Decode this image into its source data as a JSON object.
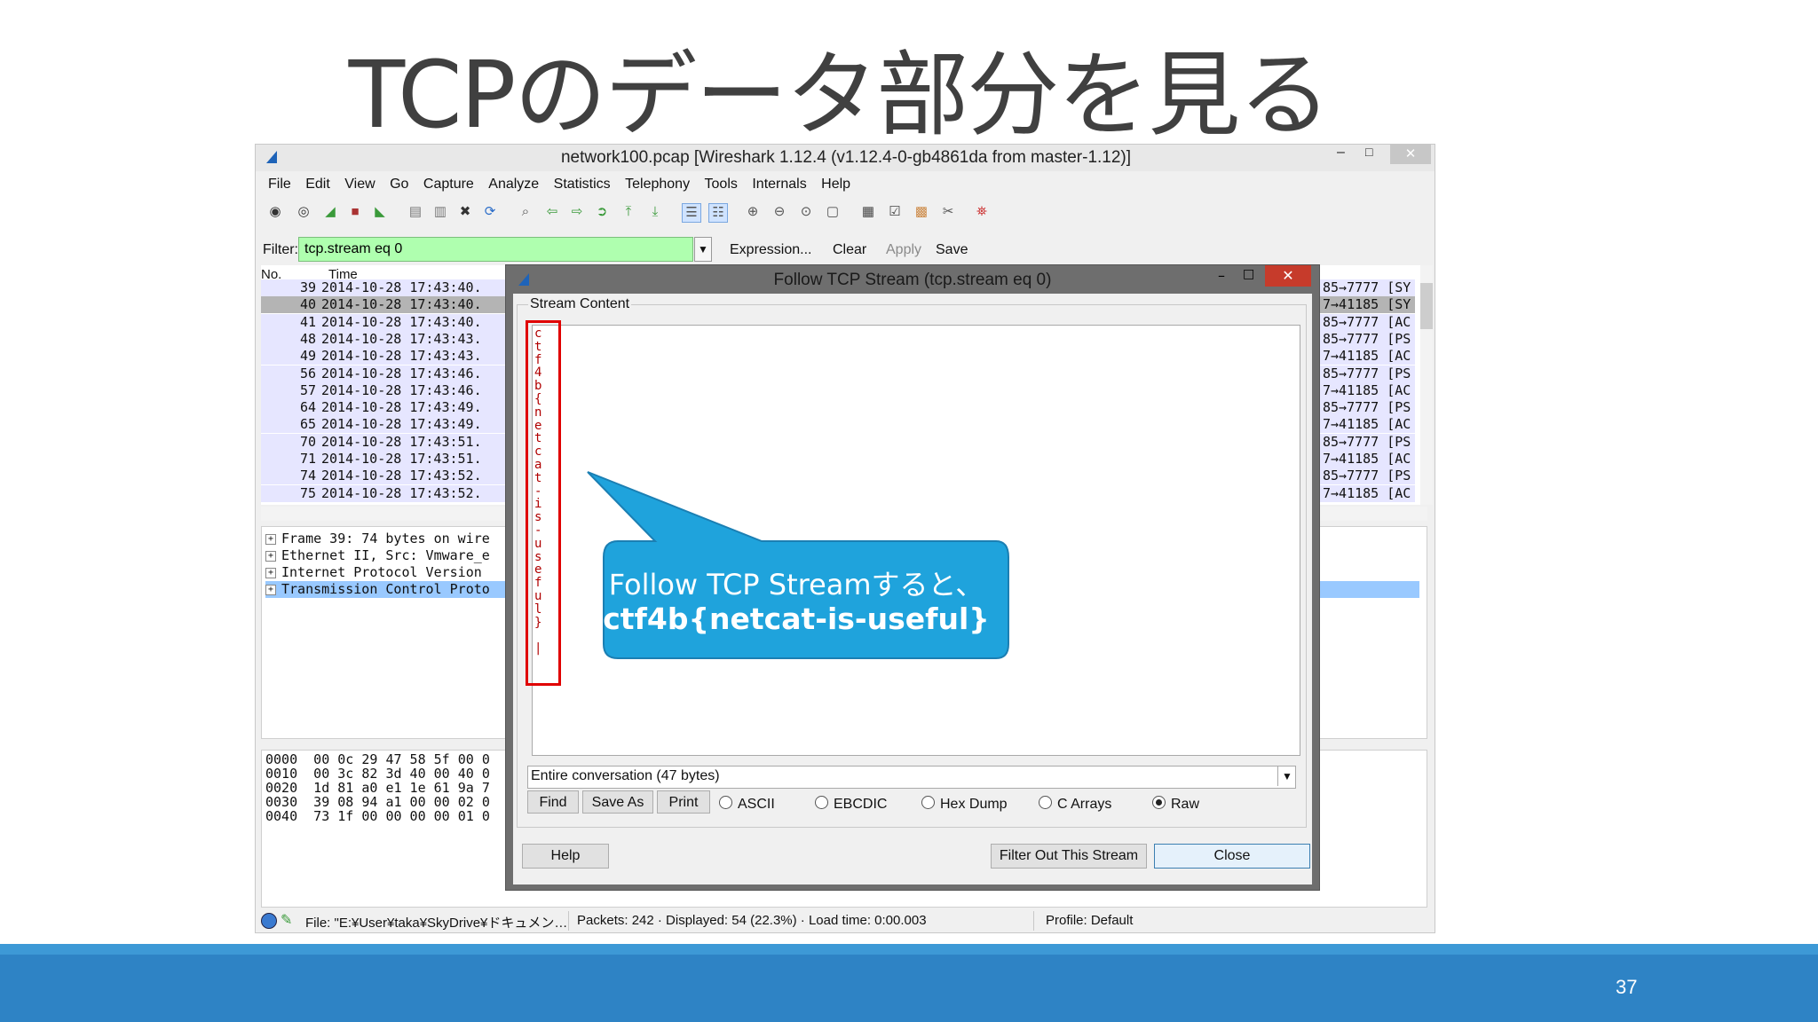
{
  "slide": {
    "title": "TCPのデータ部分を見る",
    "page_number": "37",
    "callout_line1": "Follow TCP Streamすると、",
    "callout_line2": "ctf4b{netcat-is-useful}"
  },
  "wireshark": {
    "window_title": "network100.pcap   [Wireshark 1.12.4  (v1.12.4-0-gb4861da from master-1.12)]",
    "window_buttons": {
      "minimize": "–",
      "maximize": "□",
      "close": "✕"
    },
    "menu": [
      "File",
      "Edit",
      "View",
      "Go",
      "Capture",
      "Analyze",
      "Statistics",
      "Telephony",
      "Tools",
      "Internals",
      "Help"
    ],
    "toolbar_icons": [
      "interfaces-icon",
      "options-icon",
      "start-capture-icon",
      "stop-capture-icon",
      "restart-capture-icon",
      "open-file-icon",
      "save-file-icon",
      "close-file-icon",
      "reload-icon",
      "find-packet-icon",
      "go-back-icon",
      "go-forward-icon",
      "go-to-packet-icon",
      "go-first-icon",
      "go-last-icon",
      "colorize-icon",
      "autoscroll-icon",
      "zoom-in-icon",
      "zoom-out-icon",
      "normal-size-icon",
      "resize-columns-icon",
      "capture-filters-icon",
      "display-filters-icon",
      "coloring-rules-icon",
      "preferences-icon",
      "help-icon"
    ],
    "filter": {
      "label": "Filter:",
      "value": "tcp.stream eq 0",
      "expression": "Expression...",
      "clear": "Clear",
      "apply": "Apply",
      "save": "Save"
    },
    "packet_list": {
      "headers": {
        "no": "No.",
        "time": "Time"
      },
      "rows": [
        {
          "no": "39",
          "time": "2014-10-28 17:43:40.",
          "info": "85→7777 [SY"
        },
        {
          "no": "40",
          "time": "2014-10-28 17:43:40.",
          "info": "7→41185 [SY"
        },
        {
          "no": "41",
          "time": "2014-10-28 17:43:40.",
          "info": "85→7777 [AC"
        },
        {
          "no": "48",
          "time": "2014-10-28 17:43:43.",
          "info": "85→7777 [PS"
        },
        {
          "no": "49",
          "time": "2014-10-28 17:43:43.",
          "info": "7→41185 [AC"
        },
        {
          "no": "56",
          "time": "2014-10-28 17:43:46.",
          "info": "85→7777 [PS"
        },
        {
          "no": "57",
          "time": "2014-10-28 17:43:46.",
          "info": "7→41185 [AC"
        },
        {
          "no": "64",
          "time": "2014-10-28 17:43:49.",
          "info": "85→7777 [PS"
        },
        {
          "no": "65",
          "time": "2014-10-28 17:43:49.",
          "info": "7→41185 [AC"
        },
        {
          "no": "70",
          "time": "2014-10-28 17:43:51.",
          "info": "85→7777 [PS"
        },
        {
          "no": "71",
          "time": "2014-10-28 17:43:51.",
          "info": "7→41185 [AC"
        },
        {
          "no": "74",
          "time": "2014-10-28 17:43:52.",
          "info": "85→7777 [PS"
        },
        {
          "no": "75",
          "time": "2014-10-28 17:43:52.",
          "info": "7→41185 [AC"
        }
      ]
    },
    "details": [
      "Frame 39: 74 bytes on wire",
      "Ethernet II, Src: Vmware_e",
      "Internet Protocol Version",
      "Transmission Control Proto"
    ],
    "bytes": [
      "0000  00 0c 29 47 58 5f 00 0",
      "0010  00 3c 82 3d 40 00 40 0",
      "0020  1d 81 a0 e1 1e 61 9a 7",
      "0030  39 08 94 a1 00 00 02 0",
      "0040  73 1f 00 00 00 00 01 0"
    ],
    "status": {
      "file": "File: \"E:¥User¥taka¥SkyDrive¥ドキュメン…",
      "packets": "Packets: 242 · Displayed: 54 (22.3%)  · Load time: 0:00.003",
      "profile": "Profile: Default"
    }
  },
  "dialog": {
    "title": "Follow TCP Stream (tcp.stream eq 0)",
    "group_label": "Stream Content",
    "stream_chars": "c\nt\nf\n4\nb\n{\nn\ne\nt\nc\na\nt\n-\ni\ns\n-\nu\ns\ne\nf\nu\nl\n}\n\n|",
    "conversation": "Entire conversation (47 bytes)",
    "buttons": {
      "find": "Find",
      "save_as": "Save As",
      "print": "Print",
      "help": "Help",
      "filter_out": "Filter Out This Stream",
      "close": "Close"
    },
    "radios": [
      {
        "label": "ASCII",
        "selected": false
      },
      {
        "label": "EBCDIC",
        "selected": false
      },
      {
        "label": "Hex Dump",
        "selected": false
      },
      {
        "label": "C Arrays",
        "selected": false
      },
      {
        "label": "Raw",
        "selected": true
      }
    ],
    "colors": {
      "highlight_border": "#e00000",
      "stream_text": "#b00000"
    }
  },
  "colors": {
    "footer": "#2e83c5",
    "callout": "#1fa3dc",
    "filter_ok": "#afffaf",
    "row_selected": "#b4b4b4",
    "row_default": "#e6e6ff"
  }
}
